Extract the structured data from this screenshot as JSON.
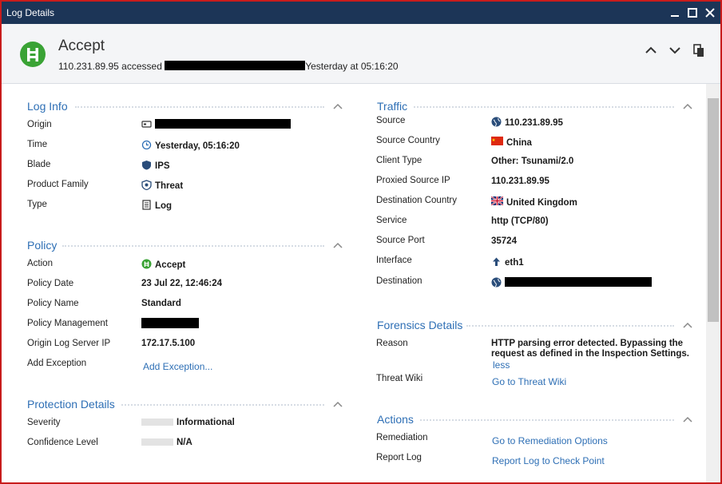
{
  "window": {
    "title": "Log Details"
  },
  "header": {
    "title": "Accept",
    "subtitle_prefix": "110.231.89.95 accessed",
    "subtitle_suffix": "Yesterday at  05:16:20"
  },
  "log_info": {
    "title": "Log Info",
    "rows": [
      {
        "label": "Origin",
        "value": ""
      },
      {
        "label": "Time",
        "value": "Yesterday, 05:16:20"
      },
      {
        "label": "Blade",
        "value": "IPS"
      },
      {
        "label": "Product Family",
        "value": "Threat"
      },
      {
        "label": "Type",
        "value": "Log"
      }
    ]
  },
  "policy": {
    "title": "Policy",
    "rows": [
      {
        "label": "Action",
        "value": "Accept"
      },
      {
        "label": "Policy Date",
        "value": "23 Jul 22, 12:46:24"
      },
      {
        "label": "Policy Name",
        "value": "Standard"
      },
      {
        "label": "Policy Management",
        "value": ""
      },
      {
        "label": "Origin Log Server IP",
        "value": "172.17.5.100"
      },
      {
        "label": "Add Exception",
        "value": "Add Exception..."
      }
    ]
  },
  "protection": {
    "title": "Protection Details",
    "rows": [
      {
        "label": "Severity",
        "value": "Informational"
      },
      {
        "label": "Confidence Level",
        "value": "N/A"
      }
    ]
  },
  "traffic": {
    "title": "Traffic",
    "rows": [
      {
        "label": "Source",
        "value": "110.231.89.95"
      },
      {
        "label": "Source Country",
        "value": "China"
      },
      {
        "label": "Client Type",
        "value": "Other: Tsunami/2.0"
      },
      {
        "label": "Proxied Source IP",
        "value": "110.231.89.95"
      },
      {
        "label": "Destination Country",
        "value": "United Kingdom"
      },
      {
        "label": "Service",
        "value": "http (TCP/80)"
      },
      {
        "label": "Source Port",
        "value": "35724"
      },
      {
        "label": "Interface",
        "value": "eth1"
      },
      {
        "label": "Destination",
        "value": ""
      }
    ]
  },
  "forensics": {
    "title": "Forensics Details",
    "reason_label": "Reason",
    "reason_line1": "HTTP parsing error detected. Bypassing the",
    "reason_line2": "request as defined in the Inspection Settings.",
    "less_link": "less",
    "wiki_label": "Threat Wiki",
    "wiki_link": "Go to Threat Wiki"
  },
  "actions": {
    "title": "Actions",
    "remediation_label": "Remediation",
    "remediation_link": "Go to Remediation Options",
    "report_label": "Report Log",
    "report_link": "Report Log to Check Point"
  },
  "colors": {
    "titlebar": "#1c3557",
    "accent_link": "#2e6fb5",
    "accept_green": "#3aa335",
    "window_border": "#c81c1c"
  },
  "icons": [
    "accept-icon",
    "up-arrow-icon",
    "down-arrow-icon",
    "copy-icon",
    "minimize-icon",
    "maximize-icon",
    "close-icon",
    "server-icon",
    "clock-icon",
    "shield-icon",
    "threat-icon",
    "document-icon",
    "globe-icon",
    "china-flag-icon",
    "uk-flag-icon",
    "upload-arrow-icon"
  ]
}
